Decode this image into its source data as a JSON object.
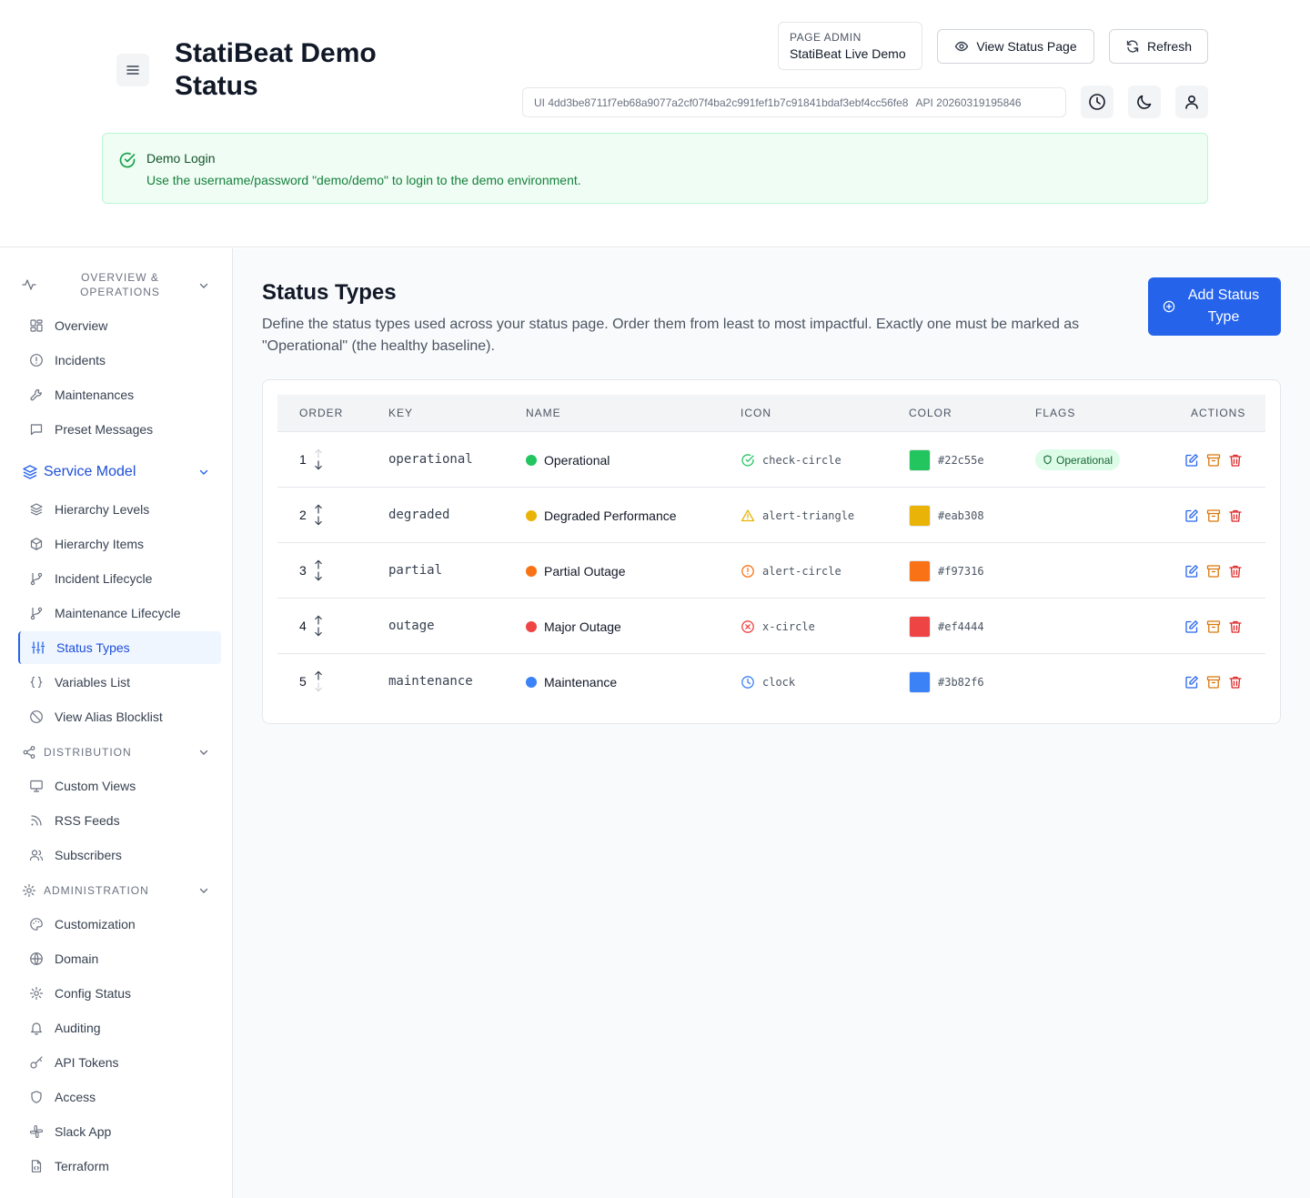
{
  "header": {
    "title": "StatiBeat Demo Status",
    "page_admin_label": "PAGE ADMIN",
    "page_admin_value": "StatiBeat Live Demo",
    "view_status_label": "View Status Page",
    "refresh_label": "Refresh",
    "version_ui": "UI 4dd3be8711f7eb68a9077a2cf07f4ba2c991fef1b7c91841bdaf3ebf4cc56fe8",
    "version_api": "API 20260319195846"
  },
  "alert": {
    "title": "Demo Login",
    "text": "Use the username/password \"demo/demo\" to login to the demo environment."
  },
  "sidebar": {
    "overview_section": "OVERVIEW & OPERATIONS",
    "overview_items": [
      "Overview",
      "Incidents",
      "Maintenances",
      "Preset Messages"
    ],
    "service_model_section": "Service Model",
    "service_items": [
      "Hierarchy Levels",
      "Hierarchy Items",
      "Incident Lifecycle",
      "Maintenance Lifecycle",
      "Status Types",
      "Variables List",
      "View Alias Blocklist"
    ],
    "distribution_section": "DISTRIBUTION",
    "distribution_items": [
      "Custom Views",
      "RSS Feeds",
      "Subscribers"
    ],
    "administration_section": "ADMINISTRATION",
    "administration_items": [
      "Customization",
      "Domain",
      "Config Status",
      "Auditing",
      "API Tokens",
      "Access",
      "Slack App",
      "Terraform"
    ]
  },
  "main": {
    "title": "Status Types",
    "description": "Define the status types used across your status page. Order them from least to most impactful. Exactly one must be marked as \"Operational\" (the healthy baseline).",
    "add_button": "Add Status Type",
    "columns": [
      "ORDER",
      "KEY",
      "NAME",
      "ICON",
      "COLOR",
      "FLAGS",
      "ACTIONS"
    ],
    "rows": [
      {
        "order": "1",
        "key": "operational",
        "name": "Operational",
        "icon": "check-circle",
        "color": "#22c55e",
        "flag": "Operational"
      },
      {
        "order": "2",
        "key": "degraded",
        "name": "Degraded Performance",
        "icon": "alert-triangle",
        "color": "#eab308",
        "flag": ""
      },
      {
        "order": "3",
        "key": "partial",
        "name": "Partial Outage",
        "icon": "alert-circle",
        "color": "#f97316",
        "flag": ""
      },
      {
        "order": "4",
        "key": "outage",
        "name": "Major Outage",
        "icon": "x-circle",
        "color": "#ef4444",
        "flag": ""
      },
      {
        "order": "5",
        "key": "maintenance",
        "name": "Maintenance",
        "icon": "clock",
        "color": "#3b82f6",
        "flag": ""
      }
    ]
  },
  "colors": {
    "accent": "#2563eb",
    "edit": "#2563eb",
    "archive": "#d97706",
    "delete": "#dc2626"
  }
}
